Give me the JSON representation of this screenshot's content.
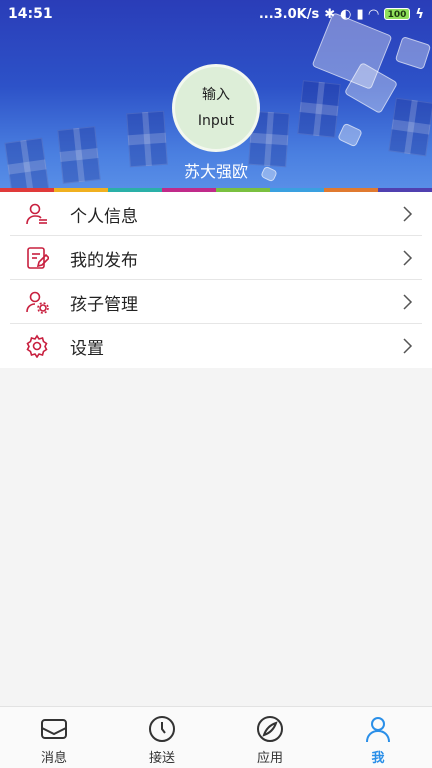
{
  "status_bar": {
    "time": "14:51",
    "network_speed": "...3.0K/s",
    "battery": "100"
  },
  "profile": {
    "avatar_line1": "输入",
    "avatar_line2": "Input",
    "username": "苏大强欧"
  },
  "colors": {
    "accent": "#c8203f",
    "active_tab": "#2a8fe8",
    "strip": [
      "#e03a3a",
      "#f0b020",
      "#2ab0a8",
      "#c02a8a",
      "#7ac040",
      "#3aa0e0",
      "#e07a30",
      "#5040b0"
    ]
  },
  "menu": {
    "items": [
      {
        "label": "个人信息",
        "icon": "user-profile-icon"
      },
      {
        "label": "我的发布",
        "icon": "edit-document-icon"
      },
      {
        "label": "孩子管理",
        "icon": "user-settings-icon"
      },
      {
        "label": "设置",
        "icon": "gear-icon"
      }
    ]
  },
  "bottom_nav": {
    "items": [
      {
        "label": "消息",
        "icon": "envelope-icon",
        "active": false
      },
      {
        "label": "接送",
        "icon": "clock-icon",
        "active": false
      },
      {
        "label": "应用",
        "icon": "compass-icon",
        "active": false
      },
      {
        "label": "我",
        "icon": "person-icon",
        "active": true
      }
    ]
  }
}
